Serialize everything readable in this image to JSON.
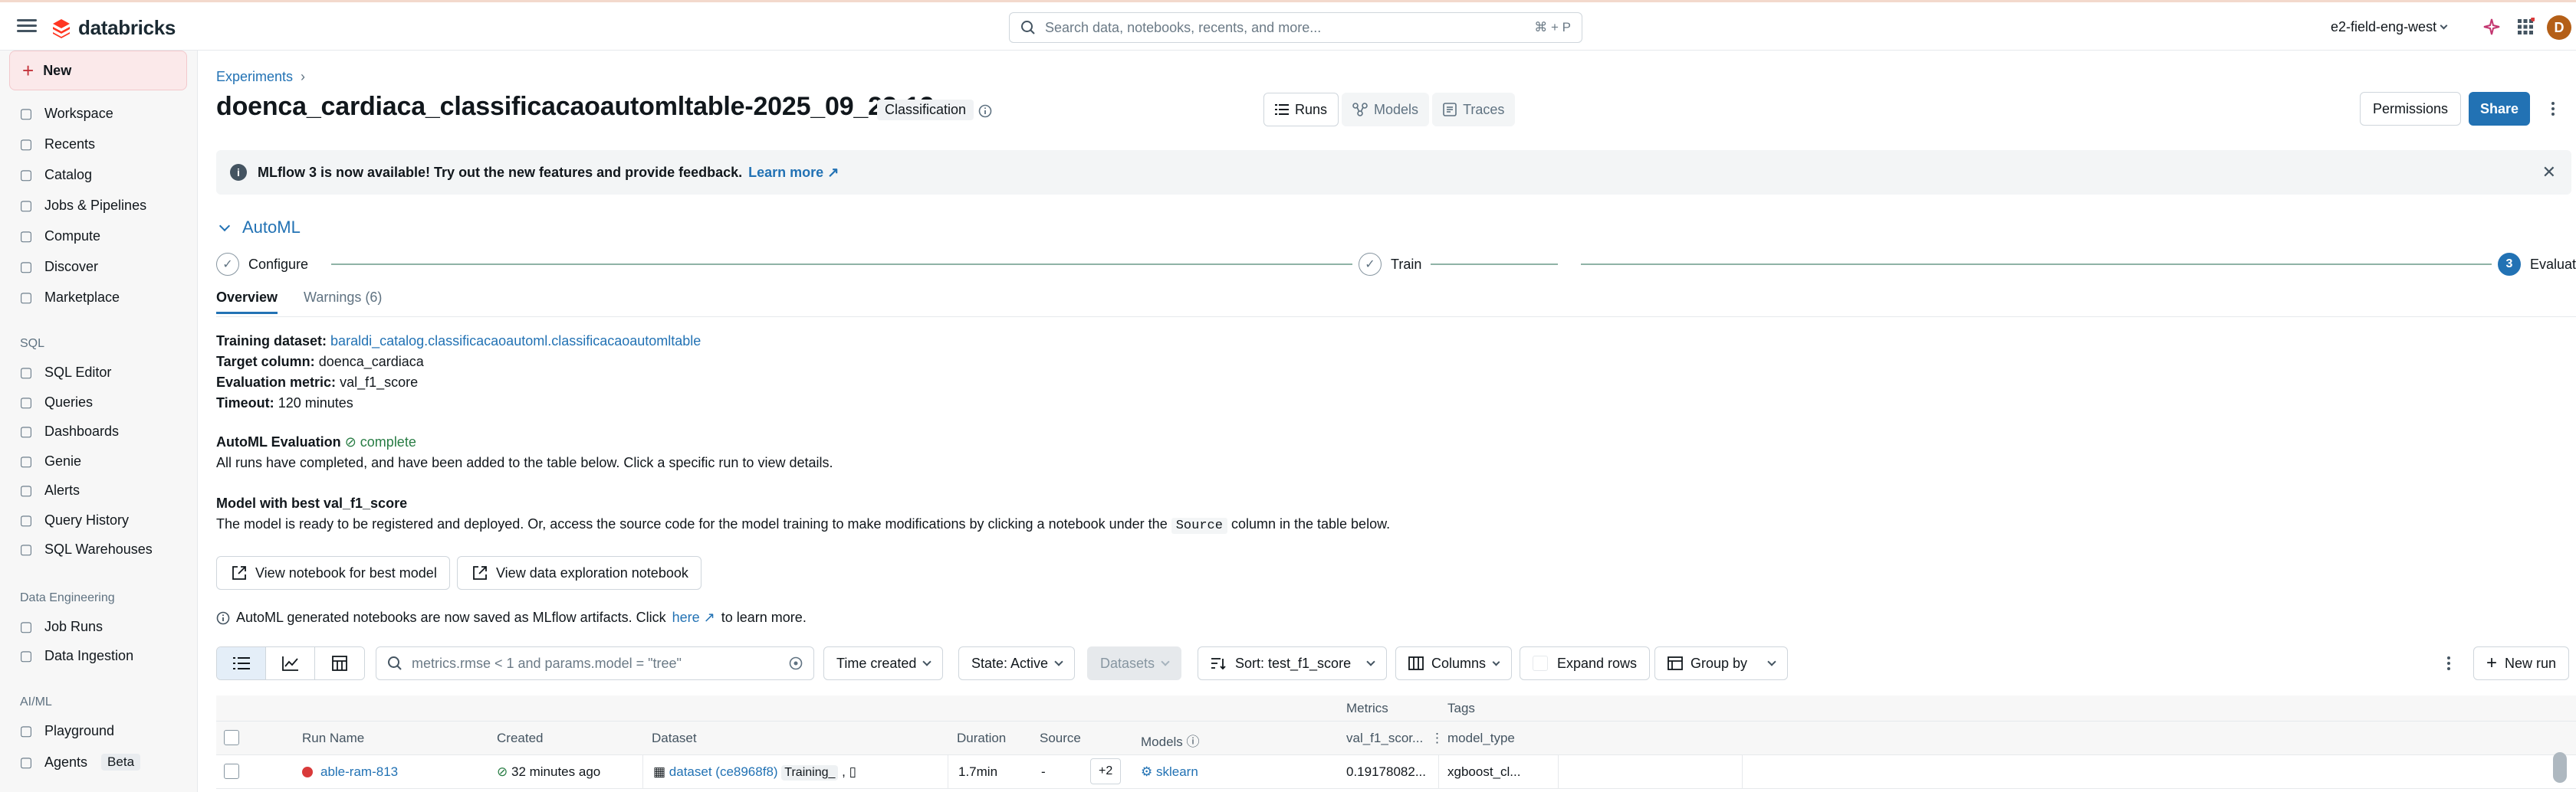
{
  "topbar": {
    "brand": "databricks",
    "search_placeholder": "Search data, notebooks, recents, and more...",
    "search_shortcut": "⌘ + P",
    "workspace": "e2-field-eng-west",
    "avatar_letter": "D"
  },
  "sidebar": {
    "new_label": "New",
    "items_main": [
      {
        "label": "Workspace",
        "icon": "folder-icon"
      },
      {
        "label": "Recents",
        "icon": "clock-icon"
      },
      {
        "label": "Catalog",
        "icon": "catalog-icon"
      },
      {
        "label": "Jobs & Pipelines",
        "icon": "workflow-icon"
      },
      {
        "label": "Compute",
        "icon": "cloud-icon"
      },
      {
        "label": "Discover",
        "icon": "grid-icon"
      },
      {
        "label": "Marketplace",
        "icon": "store-icon"
      }
    ],
    "section_sql": "SQL",
    "items_sql": [
      {
        "label": "SQL Editor",
        "icon": "editor-icon"
      },
      {
        "label": "Queries",
        "icon": "query-icon"
      },
      {
        "label": "Dashboards",
        "icon": "dashboard-icon"
      },
      {
        "label": "Genie",
        "icon": "genie-icon"
      },
      {
        "label": "Alerts",
        "icon": "bell-icon"
      },
      {
        "label": "Query History",
        "icon": "history-icon"
      },
      {
        "label": "SQL Warehouses",
        "icon": "warehouse-icon"
      }
    ],
    "section_data_eng": "Data Engineering",
    "items_data_eng": [
      {
        "label": "Job Runs",
        "icon": "list-icon"
      },
      {
        "label": "Data Ingestion",
        "icon": "ingest-icon"
      }
    ],
    "section_aiml": "AI/ML",
    "items_aiml": [
      {
        "label": "Playground",
        "icon": "playground-icon"
      },
      {
        "label": "Agents",
        "icon": "agent-icon",
        "badge": "Beta"
      }
    ]
  },
  "header": {
    "breadcrumb": "Experiments",
    "title": "doenca_cardiaca_classificacaoautomltable-2025_09_23-12_...",
    "tag": "Classification",
    "tabs": [
      "Runs",
      "Models",
      "Traces"
    ],
    "permissions_label": "Permissions",
    "share_label": "Share"
  },
  "banner": {
    "text": "MLflow 3 is now available! Try out the new features and provide feedback.",
    "link": "Learn more"
  },
  "automl": {
    "heading": "AutoML",
    "steps": [
      {
        "label": "Configure",
        "state": "done"
      },
      {
        "label": "Train",
        "state": "done"
      },
      {
        "label": "Evaluate",
        "state": "current",
        "number": "3"
      }
    ],
    "tabs": {
      "overview": "Overview",
      "warnings": "Warnings (6)"
    },
    "training_dataset_label": "Training dataset:",
    "training_dataset_value": "baraldi_catalog.classificacaoautoml.classificacaoautomltable",
    "target_label": "Target column:",
    "target_value": "doenca_cardiaca",
    "metric_label": "Evaluation metric:",
    "metric_value": "val_f1_score",
    "timeout_label": "Timeout:",
    "timeout_value": "120 minutes",
    "eval_label": "AutoML Evaluation",
    "eval_status": "complete",
    "eval_desc": "All runs have completed, and have been added to the table below. Click a specific run to view details.",
    "best_title": "Model with best val_f1_score",
    "best_desc_a": "The model is ready to be registered and deployed. Or, access the source code for the model training to make modifications by clicking a notebook under the",
    "best_desc_code": "Source",
    "best_desc_b": "column in the table below.",
    "btn_best": "View notebook for best model",
    "btn_explore": "View data exploration notebook",
    "note_a": "AutoML generated notebooks are now saved as MLflow artifacts. Click",
    "note_link": "here",
    "note_b": "to learn more."
  },
  "toolbar": {
    "filter_placeholder": "metrics.rmse < 1 and params.model = \"tree\"",
    "time_created": "Time created",
    "state": "State: Active",
    "datasets": "Datasets",
    "sort": "Sort: test_f1_score",
    "columns": "Columns",
    "expand_rows": "Expand rows",
    "group_by": "Group by",
    "new_run": "New run"
  },
  "table": {
    "group_metrics": "Metrics",
    "group_tags": "Tags",
    "columns": [
      "Run Name",
      "Created",
      "Dataset",
      "Duration",
      "Source",
      "Models",
      "val_f1_scor...",
      "model_type"
    ],
    "rows": [
      {
        "run_name": "able-ram-813",
        "created": "32 minutes ago",
        "dataset": "dataset (ce8968f8)",
        "dataset_tag": "Training_",
        "dataset_more": "+2",
        "duration": "1.7min",
        "source": "-",
        "model": "sklearn",
        "metric": "0.19178082...",
        "model_type": "xgboost_cl..."
      }
    ]
  }
}
